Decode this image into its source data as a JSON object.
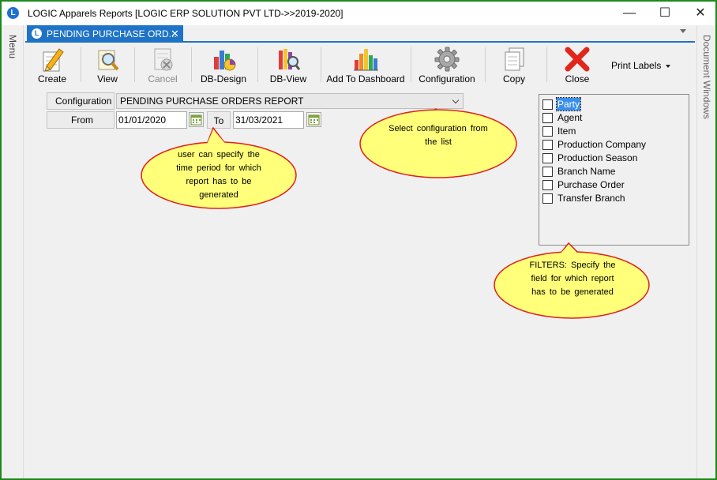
{
  "window": {
    "title": "LOGIC Apparels Reports  [LOGIC ERP SOLUTION PVT LTD->>2019-2020]",
    "controls": {
      "minimize": "—",
      "maximize": "☐",
      "close": "✕"
    }
  },
  "side": {
    "left_label": "Menu",
    "right_label": "Document Windows"
  },
  "tab": {
    "label": "PENDING PURCHASE ORD...",
    "close": "✕"
  },
  "toolbar": {
    "create": "Create",
    "view": "View",
    "cancel": "Cancel",
    "db_design": "DB-Design",
    "db_view": "DB-View",
    "add_dashboard": "Add To Dashboard",
    "configuration": "Configuration",
    "copy": "Copy",
    "close": "Close",
    "print_labels": "Print Labels"
  },
  "form": {
    "configuration_label": "Configuration",
    "configuration_value": "PENDING PURCHASE ORDERS REPORT",
    "from_label": "From",
    "from_value": "01/01/2020",
    "to_label": "To",
    "to_value": "31/03/2021"
  },
  "filters": [
    {
      "label": "Party",
      "checked": false,
      "selected": true
    },
    {
      "label": "Agent",
      "checked": false,
      "selected": false
    },
    {
      "label": "Item",
      "checked": false,
      "selected": false
    },
    {
      "label": "Production Company",
      "checked": false,
      "selected": false
    },
    {
      "label": "Production Season",
      "checked": false,
      "selected": false
    },
    {
      "label": "Branch Name",
      "checked": false,
      "selected": false
    },
    {
      "label": "Purchase Order",
      "checked": false,
      "selected": false
    },
    {
      "label": "Transfer Branch",
      "checked": false,
      "selected": false
    }
  ],
  "callouts": {
    "time_period": "user can specify the time period for which report has to be generated",
    "configuration": "Select configuration from the list",
    "filters": "FILTERS: Specify the field for which report has to be generated"
  },
  "colors": {
    "accent": "#1f73c6",
    "window_border": "#1c8a1c",
    "callout_fill": "#ffff7a",
    "callout_stroke": "#e0201a",
    "selection": "#3b8ee8"
  }
}
